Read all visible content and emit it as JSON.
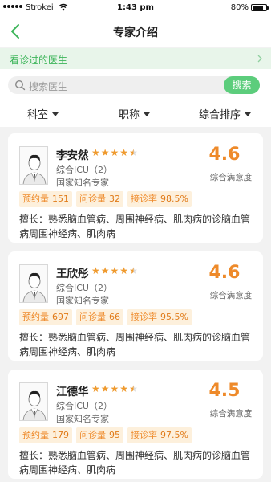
{
  "status_bar": {
    "carrier": "Strokei",
    "time": "1:43 pm",
    "battery": "80%",
    "battery_level": 0.8
  },
  "nav": {
    "title": "专家介绍"
  },
  "visited": {
    "label": "看诊过的医生"
  },
  "search": {
    "placeholder": "搜索医生",
    "button": "搜索"
  },
  "filters": [
    {
      "label": "科室"
    },
    {
      "label": "职称"
    },
    {
      "label": "综合排序"
    }
  ],
  "colors": {
    "accent_green": "#3db55a",
    "accent_orange": "#ee8a2a",
    "star": "#ef9a2e"
  },
  "doctors": [
    {
      "name": "李安然",
      "rating": 4.5,
      "dept": "综合ICU（2）",
      "title": "国家知名专家",
      "score": "4.6",
      "score_label": "综合满意度",
      "stats": [
        {
          "label": "预约量",
          "value": "151"
        },
        {
          "label": "问诊量",
          "value": "32"
        },
        {
          "label": "接诊率",
          "value": "98.5%"
        }
      ],
      "expertise": "擅长：熟悉脑血管病、周围神经病、肌肉病的诊脑血管病周围神经病、肌肉病"
    },
    {
      "name": "王欣彤",
      "rating": 4.5,
      "dept": "综合ICU（2）",
      "title": "国家知名专家",
      "score": "4.6",
      "score_label": "综合满意度",
      "stats": [
        {
          "label": "预约量",
          "value": "697"
        },
        {
          "label": "问诊量",
          "value": "66"
        },
        {
          "label": "接诊率",
          "value": "95.5%"
        }
      ],
      "expertise": "擅长：熟悉脑血管病、周围神经病、肌肉病的诊脑血管病周围神经病、肌肉病"
    },
    {
      "name": "江德华",
      "rating": 4.5,
      "dept": "综合ICU（2）",
      "title": "国家知名专家",
      "score": "4.5",
      "score_label": "综合满意度",
      "stats": [
        {
          "label": "预约量",
          "value": "179"
        },
        {
          "label": "问诊量",
          "value": "95"
        },
        {
          "label": "接诊率",
          "value": "97.5%"
        }
      ],
      "expertise": "擅长：熟悉脑血管病、周围神经病、肌肉病的诊脑血管病周围神经病、肌肉病"
    }
  ]
}
